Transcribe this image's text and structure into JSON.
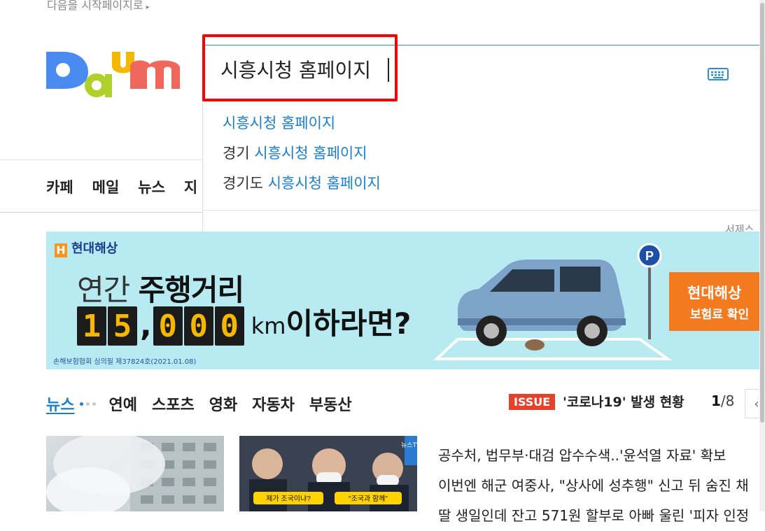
{
  "start_page_link": "다음을 시작페이지로",
  "logo_alt": "Daum",
  "search": {
    "value": "시흥시청 홈페이지",
    "suggestions": [
      {
        "prefix": "",
        "match": "시흥시청 홈페이지"
      },
      {
        "prefix": "경기 ",
        "match": "시흥시청 홈페이지"
      },
      {
        "prefix": "경기도 ",
        "match": "시흥시청 홈페이지"
      }
    ],
    "footer": "서제스"
  },
  "nav": {
    "items": [
      "카페",
      "메일",
      "뉴스",
      "지"
    ]
  },
  "banner": {
    "brand": "현대해상",
    "headline_light": "연간 ",
    "headline_bold": "주행거리",
    "odometer_digits": [
      "1",
      "5",
      "0",
      "0",
      "0"
    ],
    "odometer_comma": ",",
    "unit": "km",
    "tail": "이하라면?",
    "legal": "손해보험협회 심의필 제37824호(2021.01.08)",
    "cta_title": "현대해상",
    "cta_subtitle": "보험료 확인",
    "parking_sign": "P"
  },
  "news_tabs": {
    "items": [
      "뉴스",
      "연예",
      "스포츠",
      "영화",
      "자동차",
      "부동산"
    ]
  },
  "issue": {
    "badge": "ISSUE",
    "text": "'코로나19' 발생 현황",
    "page_current": "1",
    "page_total": "/8",
    "prev_label": "‹"
  },
  "thumbnails": {
    "thumb2_caption_left": "제가 조국이냐?",
    "thumb2_caption_right": "\"조국과 함께\"",
    "thumb2_tag": "뉴스TV"
  },
  "headlines": [
    "공수처, 법무부·대검 압수수색..'윤석열 자료' 확보",
    "이번엔 해군 여중사, \"상사에 성추행\" 신고 뒤 숨진 채",
    "딸 생일인데 잔고 571원 할부로 아빠 울린 '피자 인정"
  ],
  "colors": {
    "accent_blue": "#1a7fcf",
    "highlight_red": "#ff0000",
    "issue_red": "#e5412b",
    "banner_bg": "#b8eaf1",
    "cta_orange": "#f47a20"
  }
}
